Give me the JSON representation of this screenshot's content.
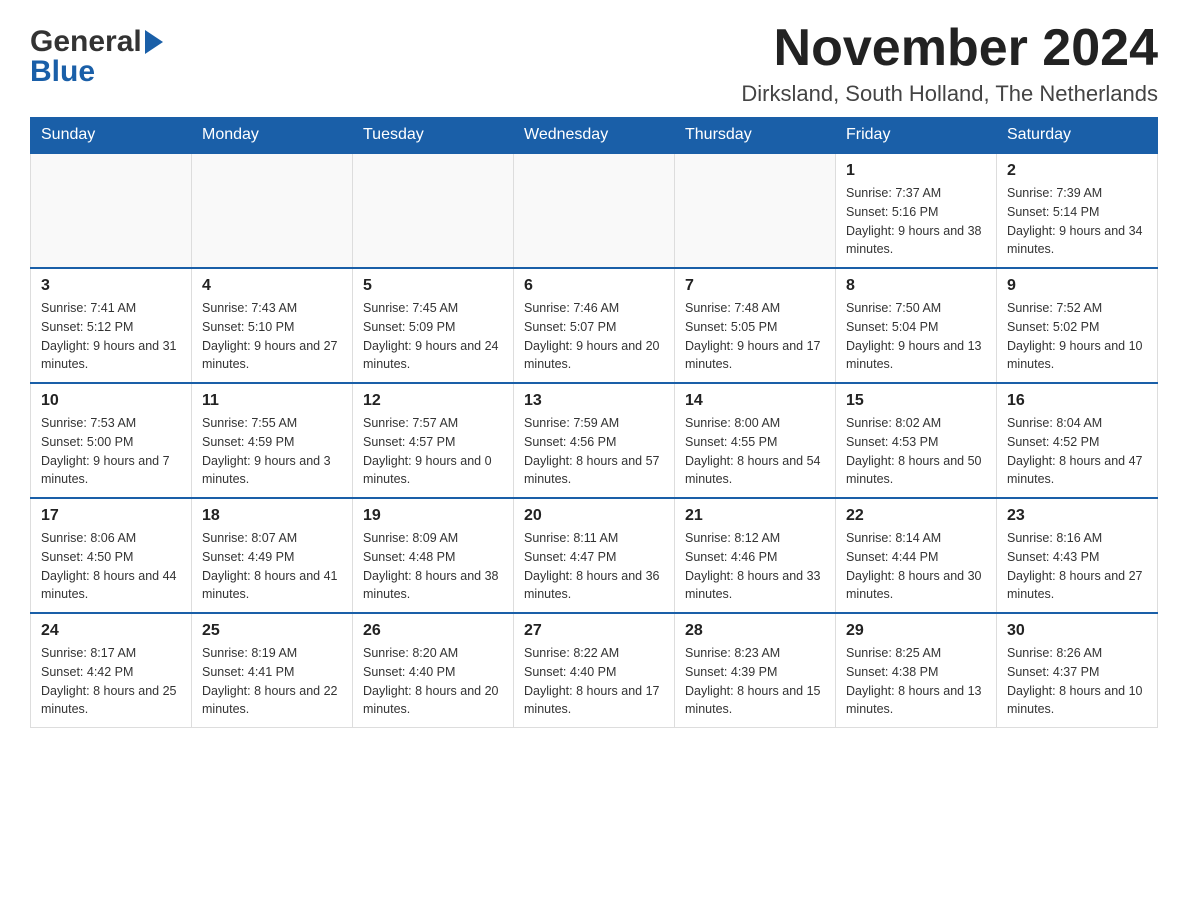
{
  "logo": {
    "general": "General",
    "blue": "Blue"
  },
  "title": "November 2024",
  "location": "Dirksland, South Holland, The Netherlands",
  "days_of_week": [
    "Sunday",
    "Monday",
    "Tuesday",
    "Wednesday",
    "Thursday",
    "Friday",
    "Saturday"
  ],
  "weeks": [
    [
      {
        "day": "",
        "sunrise": "",
        "sunset": "",
        "daylight": ""
      },
      {
        "day": "",
        "sunrise": "",
        "sunset": "",
        "daylight": ""
      },
      {
        "day": "",
        "sunrise": "",
        "sunset": "",
        "daylight": ""
      },
      {
        "day": "",
        "sunrise": "",
        "sunset": "",
        "daylight": ""
      },
      {
        "day": "",
        "sunrise": "",
        "sunset": "",
        "daylight": ""
      },
      {
        "day": "1",
        "sunrise": "Sunrise: 7:37 AM",
        "sunset": "Sunset: 5:16 PM",
        "daylight": "Daylight: 9 hours and 38 minutes."
      },
      {
        "day": "2",
        "sunrise": "Sunrise: 7:39 AM",
        "sunset": "Sunset: 5:14 PM",
        "daylight": "Daylight: 9 hours and 34 minutes."
      }
    ],
    [
      {
        "day": "3",
        "sunrise": "Sunrise: 7:41 AM",
        "sunset": "Sunset: 5:12 PM",
        "daylight": "Daylight: 9 hours and 31 minutes."
      },
      {
        "day": "4",
        "sunrise": "Sunrise: 7:43 AM",
        "sunset": "Sunset: 5:10 PM",
        "daylight": "Daylight: 9 hours and 27 minutes."
      },
      {
        "day": "5",
        "sunrise": "Sunrise: 7:45 AM",
        "sunset": "Sunset: 5:09 PM",
        "daylight": "Daylight: 9 hours and 24 minutes."
      },
      {
        "day": "6",
        "sunrise": "Sunrise: 7:46 AM",
        "sunset": "Sunset: 5:07 PM",
        "daylight": "Daylight: 9 hours and 20 minutes."
      },
      {
        "day": "7",
        "sunrise": "Sunrise: 7:48 AM",
        "sunset": "Sunset: 5:05 PM",
        "daylight": "Daylight: 9 hours and 17 minutes."
      },
      {
        "day": "8",
        "sunrise": "Sunrise: 7:50 AM",
        "sunset": "Sunset: 5:04 PM",
        "daylight": "Daylight: 9 hours and 13 minutes."
      },
      {
        "day": "9",
        "sunrise": "Sunrise: 7:52 AM",
        "sunset": "Sunset: 5:02 PM",
        "daylight": "Daylight: 9 hours and 10 minutes."
      }
    ],
    [
      {
        "day": "10",
        "sunrise": "Sunrise: 7:53 AM",
        "sunset": "Sunset: 5:00 PM",
        "daylight": "Daylight: 9 hours and 7 minutes."
      },
      {
        "day": "11",
        "sunrise": "Sunrise: 7:55 AM",
        "sunset": "Sunset: 4:59 PM",
        "daylight": "Daylight: 9 hours and 3 minutes."
      },
      {
        "day": "12",
        "sunrise": "Sunrise: 7:57 AM",
        "sunset": "Sunset: 4:57 PM",
        "daylight": "Daylight: 9 hours and 0 minutes."
      },
      {
        "day": "13",
        "sunrise": "Sunrise: 7:59 AM",
        "sunset": "Sunset: 4:56 PM",
        "daylight": "Daylight: 8 hours and 57 minutes."
      },
      {
        "day": "14",
        "sunrise": "Sunrise: 8:00 AM",
        "sunset": "Sunset: 4:55 PM",
        "daylight": "Daylight: 8 hours and 54 minutes."
      },
      {
        "day": "15",
        "sunrise": "Sunrise: 8:02 AM",
        "sunset": "Sunset: 4:53 PM",
        "daylight": "Daylight: 8 hours and 50 minutes."
      },
      {
        "day": "16",
        "sunrise": "Sunrise: 8:04 AM",
        "sunset": "Sunset: 4:52 PM",
        "daylight": "Daylight: 8 hours and 47 minutes."
      }
    ],
    [
      {
        "day": "17",
        "sunrise": "Sunrise: 8:06 AM",
        "sunset": "Sunset: 4:50 PM",
        "daylight": "Daylight: 8 hours and 44 minutes."
      },
      {
        "day": "18",
        "sunrise": "Sunrise: 8:07 AM",
        "sunset": "Sunset: 4:49 PM",
        "daylight": "Daylight: 8 hours and 41 minutes."
      },
      {
        "day": "19",
        "sunrise": "Sunrise: 8:09 AM",
        "sunset": "Sunset: 4:48 PM",
        "daylight": "Daylight: 8 hours and 38 minutes."
      },
      {
        "day": "20",
        "sunrise": "Sunrise: 8:11 AM",
        "sunset": "Sunset: 4:47 PM",
        "daylight": "Daylight: 8 hours and 36 minutes."
      },
      {
        "day": "21",
        "sunrise": "Sunrise: 8:12 AM",
        "sunset": "Sunset: 4:46 PM",
        "daylight": "Daylight: 8 hours and 33 minutes."
      },
      {
        "day": "22",
        "sunrise": "Sunrise: 8:14 AM",
        "sunset": "Sunset: 4:44 PM",
        "daylight": "Daylight: 8 hours and 30 minutes."
      },
      {
        "day": "23",
        "sunrise": "Sunrise: 8:16 AM",
        "sunset": "Sunset: 4:43 PM",
        "daylight": "Daylight: 8 hours and 27 minutes."
      }
    ],
    [
      {
        "day": "24",
        "sunrise": "Sunrise: 8:17 AM",
        "sunset": "Sunset: 4:42 PM",
        "daylight": "Daylight: 8 hours and 25 minutes."
      },
      {
        "day": "25",
        "sunrise": "Sunrise: 8:19 AM",
        "sunset": "Sunset: 4:41 PM",
        "daylight": "Daylight: 8 hours and 22 minutes."
      },
      {
        "day": "26",
        "sunrise": "Sunrise: 8:20 AM",
        "sunset": "Sunset: 4:40 PM",
        "daylight": "Daylight: 8 hours and 20 minutes."
      },
      {
        "day": "27",
        "sunrise": "Sunrise: 8:22 AM",
        "sunset": "Sunset: 4:40 PM",
        "daylight": "Daylight: 8 hours and 17 minutes."
      },
      {
        "day": "28",
        "sunrise": "Sunrise: 8:23 AM",
        "sunset": "Sunset: 4:39 PM",
        "daylight": "Daylight: 8 hours and 15 minutes."
      },
      {
        "day": "29",
        "sunrise": "Sunrise: 8:25 AM",
        "sunset": "Sunset: 4:38 PM",
        "daylight": "Daylight: 8 hours and 13 minutes."
      },
      {
        "day": "30",
        "sunrise": "Sunrise: 8:26 AM",
        "sunset": "Sunset: 4:37 PM",
        "daylight": "Daylight: 8 hours and 10 minutes."
      }
    ]
  ]
}
